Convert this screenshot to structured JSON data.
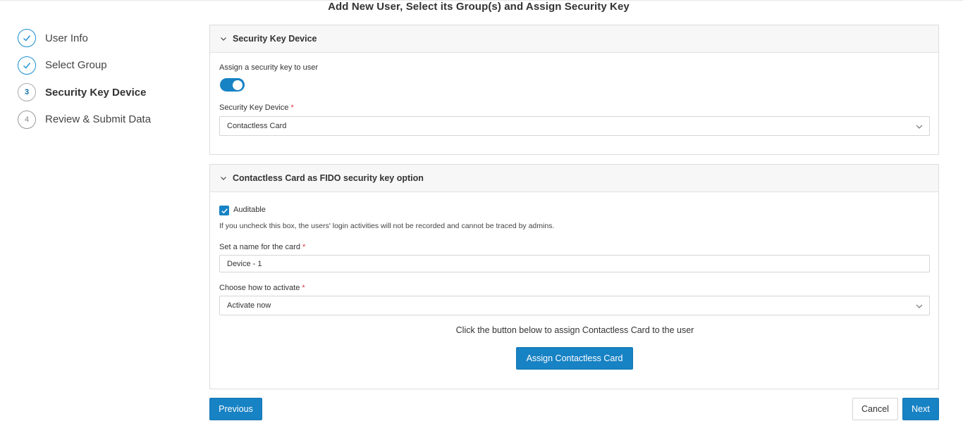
{
  "page": {
    "title": "Add New User, Select its Group(s) and Assign Security Key"
  },
  "stepper": {
    "steps": [
      {
        "number": "1",
        "label": "User Info",
        "state": "complete"
      },
      {
        "number": "2",
        "label": "Select Group",
        "state": "complete"
      },
      {
        "number": "3",
        "label": "Security Key Device",
        "state": "current"
      },
      {
        "number": "4",
        "label": "Review & Submit Data",
        "state": "pending"
      }
    ]
  },
  "security_panel": {
    "title": "Security Key Device",
    "assign_toggle_label": "Assign a security key to user",
    "assign_toggle_on": true,
    "device_label": "Security Key Device",
    "required_mark": "*",
    "device_value": "Contactless Card"
  },
  "card_panel": {
    "title": "Contactless Card as FIDO security key option",
    "auditable_label": "Auditable",
    "auditable_checked": true,
    "auditable_hint": "If you uncheck this box, the users' login activities will not be recorded and cannot be traced by admins.",
    "name_label": "Set a name for the card",
    "name_value": "Device - 1",
    "activate_label": "Choose how to activate",
    "activate_value": "Activate now",
    "instruction": "Click the button below to assign Contactless Card to the user",
    "assign_button": "Assign Contactless Card"
  },
  "footer": {
    "previous": "Previous",
    "cancel": "Cancel",
    "next": "Next"
  },
  "colors": {
    "accent": "#1782c4",
    "required": "#d9363e"
  },
  "icons": {
    "complete": "check-icon",
    "collapse": "chevron-down-icon",
    "dropdown": "chevron-down-icon"
  }
}
